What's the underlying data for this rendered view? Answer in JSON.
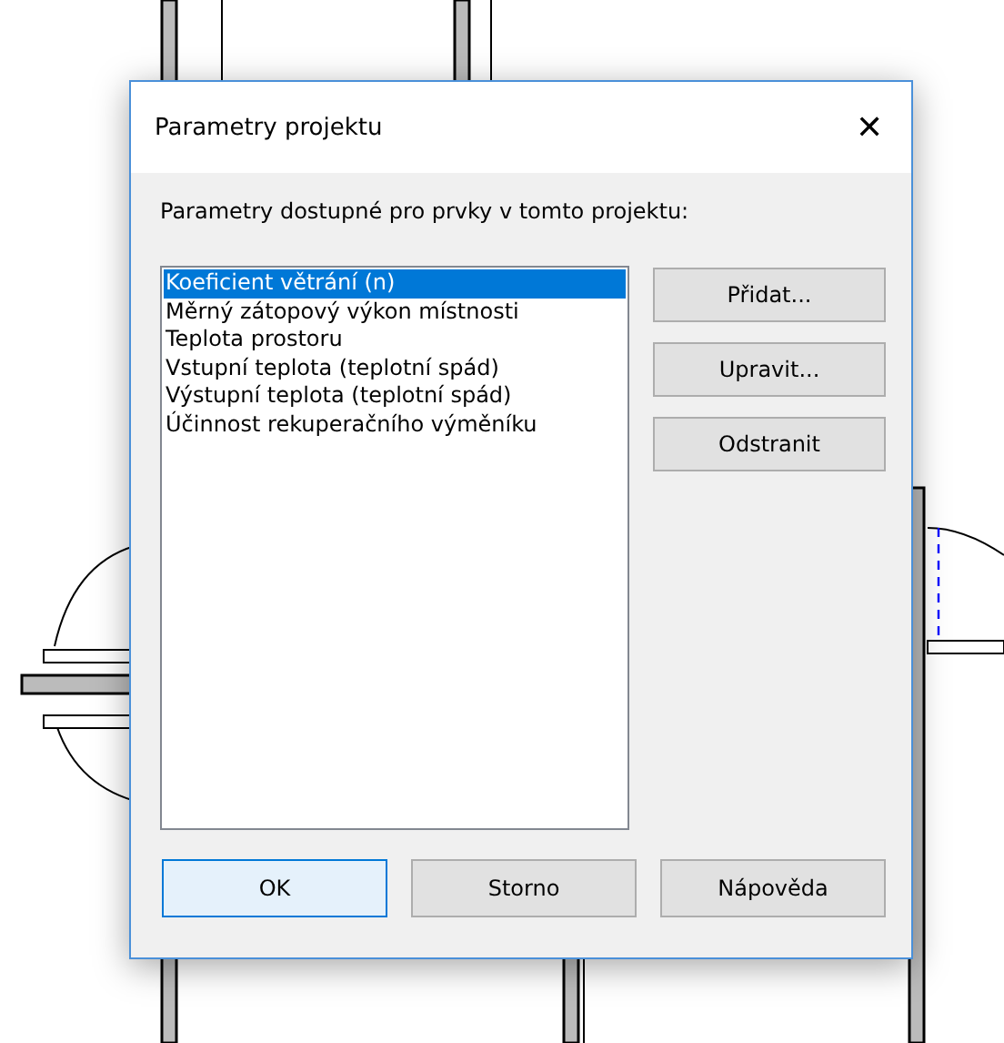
{
  "window": {
    "title": "Parametry projektu"
  },
  "close": {
    "glyph": "✕"
  },
  "prompt": "Parametry dostupné pro prvky v tomto projektu:",
  "parameters": [
    {
      "label": "Koeficient větrání (n)",
      "selected": true
    },
    {
      "label": "Měrný zátopový výkon místnosti",
      "selected": false
    },
    {
      "label": "Teplota prostoru",
      "selected": false
    },
    {
      "label": "Vstupní teplota (teplotní spád)",
      "selected": false
    },
    {
      "label": "Výstupní teplota (teplotní spád)",
      "selected": false
    },
    {
      "label": "Účinnost rekuperačního výměníku",
      "selected": false
    }
  ],
  "side_buttons": [
    "Přidat...",
    "Upravit...",
    "Odstranit"
  ],
  "buttons": [
    {
      "label": "OK",
      "default": true
    },
    {
      "label": "Storno",
      "default": false
    },
    {
      "label": "Nápověda",
      "default": false
    }
  ]
}
